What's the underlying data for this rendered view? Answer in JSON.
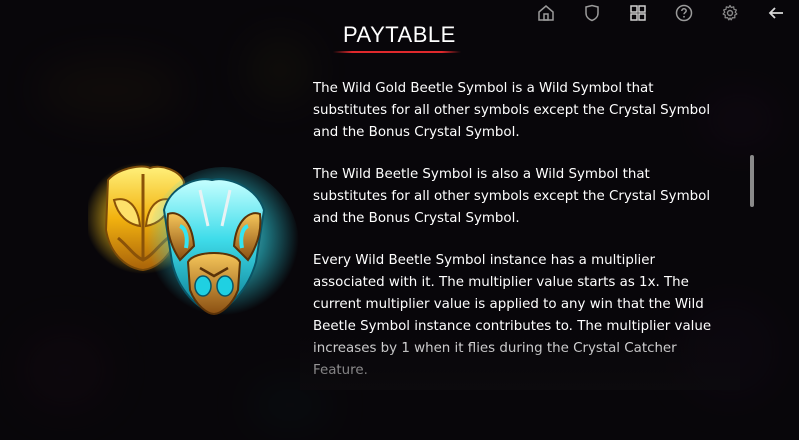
{
  "toolbar": {
    "icons": [
      "home-icon",
      "shield-icon",
      "grid-icon",
      "help-icon",
      "gear-icon",
      "back-arrow-icon"
    ]
  },
  "title": "PAYTABLE",
  "paragraphs": [
    "The Wild Gold Beetle Symbol is a Wild Symbol that substitutes for all other symbols except the Crystal Symbol and the Bonus Crystal Symbol.",
    "The Wild Beetle Symbol is also a Wild Symbol that substitutes for all other symbols except the Crystal Symbol and the Bonus Crystal Symbol.",
    "Every Wild Beetle Symbol instance has a multiplier associated with it. The multiplier value starts as 1x. The current multiplier value is applied to any win that the Wild Beetle Symbol instance contributes to. The multiplier value increases by 1 when it flies during the Crystal Catcher Feature."
  ],
  "colors": {
    "accent_line": "#e0282c",
    "gold": "#f5c21a",
    "cyan": "#2fd6e6"
  }
}
